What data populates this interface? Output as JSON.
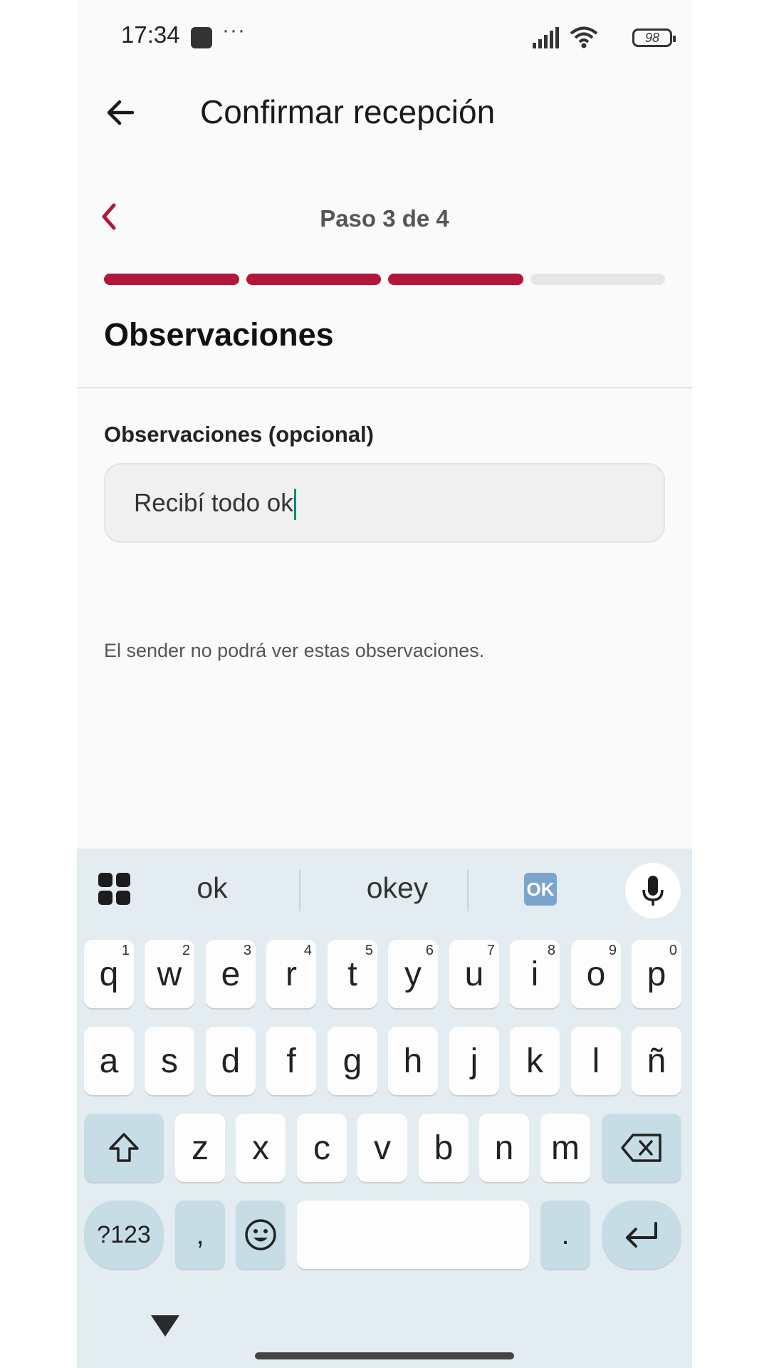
{
  "status_bar": {
    "time": "17:34",
    "more": "···",
    "battery": "98"
  },
  "app_bar": {
    "title": "Confirmar recepción"
  },
  "stepper": {
    "label": "Paso 3 de 4",
    "current": 3,
    "total": 4
  },
  "section": {
    "title": "Observaciones"
  },
  "field": {
    "label": "Observaciones (opcional)",
    "value": "Recibí todo ok",
    "hint": "El sender no podrá ver estas observaciones."
  },
  "keyboard": {
    "suggestions": [
      "ok",
      "okey"
    ],
    "emoji_suggestion": "OK",
    "row1": [
      {
        "key": "q",
        "hint": "1"
      },
      {
        "key": "w",
        "hint": "2"
      },
      {
        "key": "e",
        "hint": "3"
      },
      {
        "key": "r",
        "hint": "4"
      },
      {
        "key": "t",
        "hint": "5"
      },
      {
        "key": "y",
        "hint": "6"
      },
      {
        "key": "u",
        "hint": "7"
      },
      {
        "key": "i",
        "hint": "8"
      },
      {
        "key": "o",
        "hint": "9"
      },
      {
        "key": "p",
        "hint": "0"
      }
    ],
    "row2": [
      "a",
      "s",
      "d",
      "f",
      "g",
      "h",
      "j",
      "k",
      "l",
      "ñ"
    ],
    "row3": [
      "z",
      "x",
      "c",
      "v",
      "b",
      "n",
      "m"
    ],
    "symbols_label": "?123",
    "comma": ",",
    "period": ".",
    "icons": [
      "grid-icon",
      "microphone-icon",
      "shift-icon",
      "backspace-icon",
      "emoji-icon",
      "enter-icon",
      "hide-keyboard-icon"
    ]
  },
  "colors": {
    "accent": "#b0173a",
    "caret": "#0e8a7b",
    "keyboard_bg": "#e3ecf0",
    "function_key": "#c6dde5"
  }
}
